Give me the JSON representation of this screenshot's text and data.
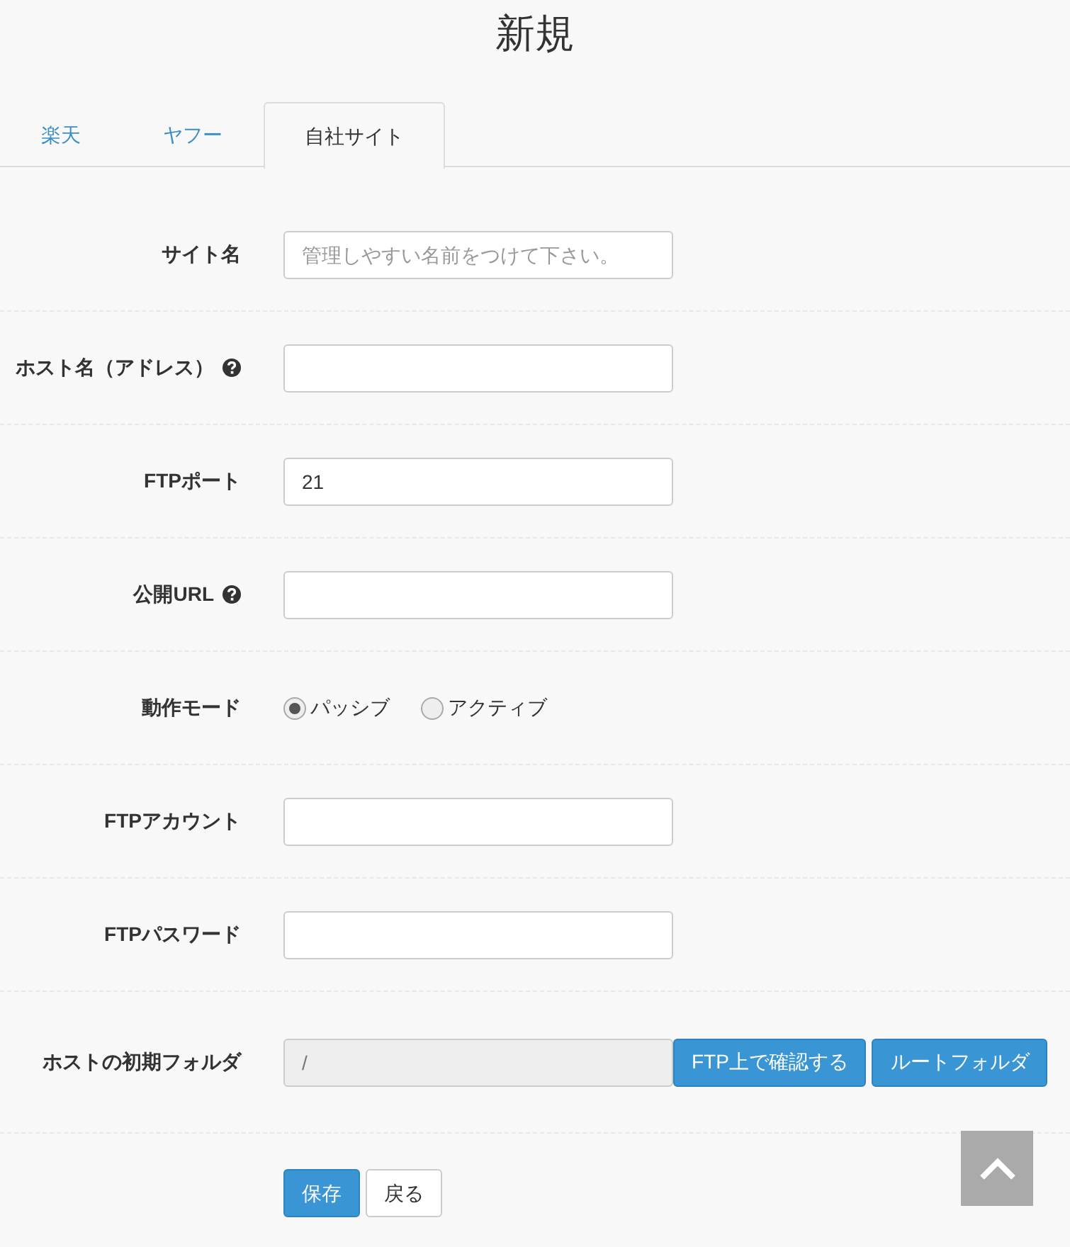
{
  "page_title": "新規",
  "tabs": [
    {
      "label": "楽天",
      "selected": false
    },
    {
      "label": "ヤフー",
      "selected": false
    },
    {
      "label": "自社サイト",
      "selected": true
    }
  ],
  "fields": [
    {
      "kind": "text",
      "label": "サイト名",
      "help": false,
      "placeholder": "管理しやすい名前をつけて下さい。"
    },
    {
      "kind": "text",
      "label": "ホスト名（アドレス）",
      "help": true
    },
    {
      "kind": "text",
      "label": "FTPポート",
      "help": false,
      "value": "21"
    },
    {
      "kind": "text",
      "label": "公開URL",
      "help": true
    },
    {
      "kind": "radio",
      "label": "動作モード",
      "help": false,
      "options": [
        {
          "label": "パッシブ",
          "selected": true
        },
        {
          "label": "アクティブ",
          "selected": false
        }
      ]
    },
    {
      "kind": "text",
      "label": "FTPアカウント",
      "help": false
    },
    {
      "kind": "text",
      "label": "FTPパスワード",
      "help": false
    },
    {
      "kind": "folder",
      "label": "ホストの初期フォルダ",
      "help": false,
      "value": "/",
      "disabled": true,
      "buttons": [
        "FTP上で確認する",
        "ルートフォルダ"
      ]
    }
  ],
  "actions": [
    {
      "label": "保存",
      "kind": "primary"
    },
    {
      "label": "戻る",
      "kind": "default"
    }
  ]
}
